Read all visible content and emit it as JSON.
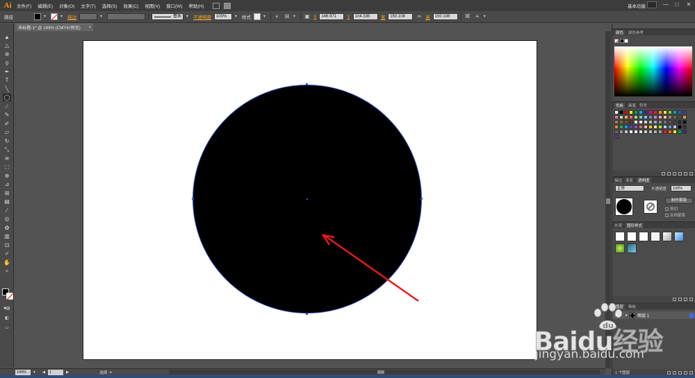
{
  "app": {
    "logo": "Ai",
    "menu": [
      "文件(F)",
      "编辑(E)",
      "对象(O)",
      "文字(T)",
      "选择(S)",
      "效果(C)",
      "视图(V)",
      "窗口(W)",
      "帮助(H)"
    ],
    "workspace_label": "基本功能",
    "window_controls": [
      "—",
      "□",
      "✕"
    ]
  },
  "control_bar": {
    "selection_label": "路径",
    "stroke_label": "描边",
    "stroke_profile": "基本",
    "opacity_label": "不透明度",
    "opacity_value": "100%",
    "style_label": "样式",
    "x_label": "X",
    "x_value": "146.971",
    "y_label": "Y",
    "y_value": "104.335",
    "w_label": "宽",
    "w_value": "150.108",
    "h_label": "高",
    "h_value": "150.108"
  },
  "document": {
    "tab_title": "未标题-1* @ 149% (CMYK/预览)",
    "close_glyph": "×"
  },
  "tools": [
    "selection-tool",
    "direct-selection-tool",
    "magic-wand-tool",
    "lasso-tool",
    "pen-tool",
    "type-tool",
    "line-tool",
    "ellipse-tool",
    "paintbrush-tool",
    "pencil-tool",
    "blob-brush-tool",
    "eraser-tool",
    "rotate-tool",
    "scale-tool",
    "warp-tool",
    "free-transform-tool",
    "shape-builder-tool",
    "perspective-grid-tool",
    "mesh-tool",
    "gradient-tool",
    "eyedropper-tool",
    "blend-tool",
    "symbol-sprayer-tool",
    "column-graph-tool",
    "artboard-tool",
    "slice-tool",
    "hand-tool",
    "zoom-tool"
  ],
  "status_bar": {
    "zoom_value": "149%",
    "page_value": "1",
    "selection_status": "选择"
  },
  "panels": {
    "color": {
      "tabs": [
        "颜色",
        "颜色参考"
      ]
    },
    "swatches": {
      "tabs": [
        "色板",
        "画笔",
        "符号"
      ],
      "colors": [
        "#ffffff",
        "#000000",
        "#ff0000",
        "#ffff00",
        "#00a651",
        "#00aeef",
        "#2e3192",
        "#ec008c",
        "#ed1c24",
        "#f7941d",
        "#fff200",
        "#8dc63f",
        "#00a99d",
        "#0072bc",
        "#662d91",
        "#f06eaa",
        "#c4df9b",
        "#fbaf5d",
        "#f26c4f",
        "#acd373",
        "#7accc8",
        "#6dcff6",
        "#8781bd",
        "#bd8cbf",
        "#f49ac1",
        "#fdc689",
        "#998675",
        "#736357",
        "#534741",
        "#c69c6d",
        "#a67c52",
        "#8c6239",
        "#754c24",
        "#603913",
        "#ffffff",
        "#f2f2f2",
        "#d9d9d9",
        "#bfbfbf",
        "#a6a6a6",
        "#8c8c8c",
        "#737373",
        "#595959",
        "#404040",
        "#262626",
        "#0d0d0d",
        "#ff7f27",
        "#22b14c",
        "#00a2e8",
        "#3f48cc",
        "#a349a4",
        "#b97a57",
        "#ffaec9",
        "#ffc90e",
        "#efe4b0",
        "#b5e61d",
        "#99d9ea",
        "#7092be",
        "#c8bfe7",
        "#000000",
        "#333333",
        "#666666",
        "#999999",
        "#cccccc",
        "#ffffff",
        "#f0f0f0",
        "#e0e0e0",
        "#d0d0d0",
        "#c0c0c0",
        "#b0b0b0",
        "#a0a0a0",
        "#ed1c24",
        "#f26522",
        "#fff200",
        "#00a651",
        "#2e3192",
        "#662d91"
      ]
    },
    "transparency": {
      "tabs": [
        "描边",
        "渐变",
        "透明度"
      ],
      "blend_mode": "正常",
      "opacity_label": "不透明度",
      "opacity_value": "100%",
      "make_mask_label": "制作蒙版",
      "clip_label": "剪切",
      "invert_label": "反相蒙版"
    },
    "graphic_styles": {
      "tabs": [
        "外观",
        "图形样式"
      ]
    },
    "layers": {
      "tabs": [
        "图层",
        "画板"
      ],
      "layer_name": "图层 1",
      "footer_count": "1 个图层"
    }
  },
  "watermark": {
    "brand": "Baidu经验",
    "url": "jingyan.baidu.com"
  },
  "artwork": {
    "fill": "#000000",
    "path_color": "#3a52c9",
    "annotation_arrow_color": "#e8191b"
  }
}
